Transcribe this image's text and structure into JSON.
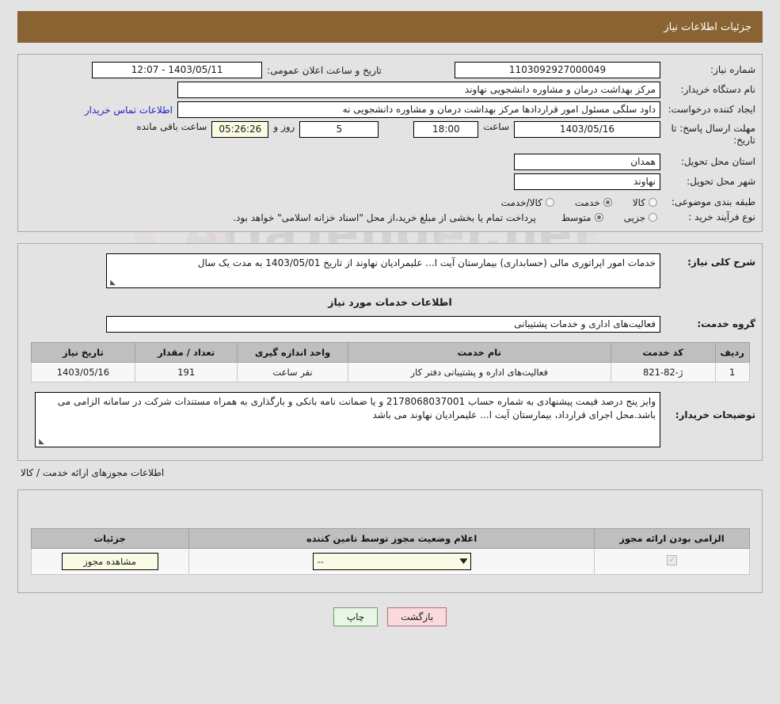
{
  "header": {
    "title": "جزئیات اطلاعات نیاز"
  },
  "form": {
    "need_number_label": "شماره نیاز:",
    "need_number_value": "1103092927000049",
    "announce_label": "تاریخ و ساعت اعلان عمومی:",
    "announce_value": "1403/05/11 - 12:07",
    "buyer_org_label": "نام دستگاه خریدار:",
    "buyer_org_value": "مرکز بهداشت  درمان و مشاوره دانشجویی نهاوند",
    "creator_label": "ایجاد کننده درخواست:",
    "creator_value": "داود سلگی مسئول امور قراردادها مرکز بهداشت  درمان و مشاوره دانشجویی نه",
    "contact_link": "اطلاعات تماس خریدار",
    "deadline_label": "مهلت ارسال پاسخ: تا تاریخ:",
    "deadline_date": "1403/05/16",
    "deadline_hour_label": "ساعت",
    "deadline_hour": "18:00",
    "days_left": "5",
    "days_unit": "روز و",
    "time_left": "05:26:26",
    "time_left_suffix": "ساعت باقی مانده",
    "province_label": "استان محل تحویل:",
    "province_value": "همدان",
    "city_label": "شهر محل تحویل:",
    "city_value": "نهاوند",
    "category_label": "طبقه بندی موضوعی:",
    "category_options": [
      {
        "label": "کالا",
        "selected": false
      },
      {
        "label": "خدمت",
        "selected": true
      },
      {
        "label": "کالا/خدمت",
        "selected": false
      }
    ],
    "process_label": "نوع فرآیند خرید :",
    "process_options": [
      {
        "label": "جزیی",
        "selected": false
      },
      {
        "label": "متوسط",
        "selected": true
      }
    ],
    "process_note": "پرداخت تمام یا بخشی از مبلغ خرید،از محل \"اسناد خزانه اسلامی\" خواهد بود."
  },
  "detail": {
    "summary_label": "شرح کلی نیاز:",
    "summary_value": "خدمات امور اپراتوری مالی (حسابداری) بیمارستان آیت ا... علیمرادیان نهاوند از تاریخ 1403/05/01 به مدت یک سال",
    "services_header": "اطلاعات خدمات مورد نیاز",
    "service_group_label": "گروه خدمت:",
    "service_group_value": "فعالیت‌های اداری و خدمات پشتیبانی",
    "table": {
      "columns": [
        "ردیف",
        "کد خدمت",
        "نام خدمت",
        "واحد اندازه گیری",
        "تعداد / مقدار",
        "تاریخ نیاز"
      ],
      "rows": [
        [
          "1",
          "ژ-82-821",
          "فعالیت‌های اداره و پشتیبانی دفتر کار",
          "نفر ساعت",
          "191",
          "1403/05/16"
        ]
      ]
    },
    "notes_label": "توضیحات خریدار:",
    "notes_value": "وایز پنج درصد قیمت پیشنهادی به شماره حساب 2178068037001 و یا ضمانت نامه بانکی و بارگذاری به همراه مستندات شرکت در سامانه الزامی می باشد.محل اجرای قرارداد، بیمارستان آیت ا... علیمرادیان نهاوند می باشد"
  },
  "permits": {
    "caption": "اطلاعات مجوزهای ارائه خدمت / کالا",
    "columns": [
      "الزامی بودن ارائه مجوز",
      "اعلام وضعیت مجوز توسط تامین کننده",
      "جزئیات"
    ],
    "rows": [
      {
        "required": true,
        "status_value": "--",
        "detail_button": "مشاهده مجوز"
      }
    ]
  },
  "footer": {
    "print_label": "چاپ",
    "back_label": "بازگشت"
  },
  "watermark": {
    "text": "AriaTender.net"
  }
}
